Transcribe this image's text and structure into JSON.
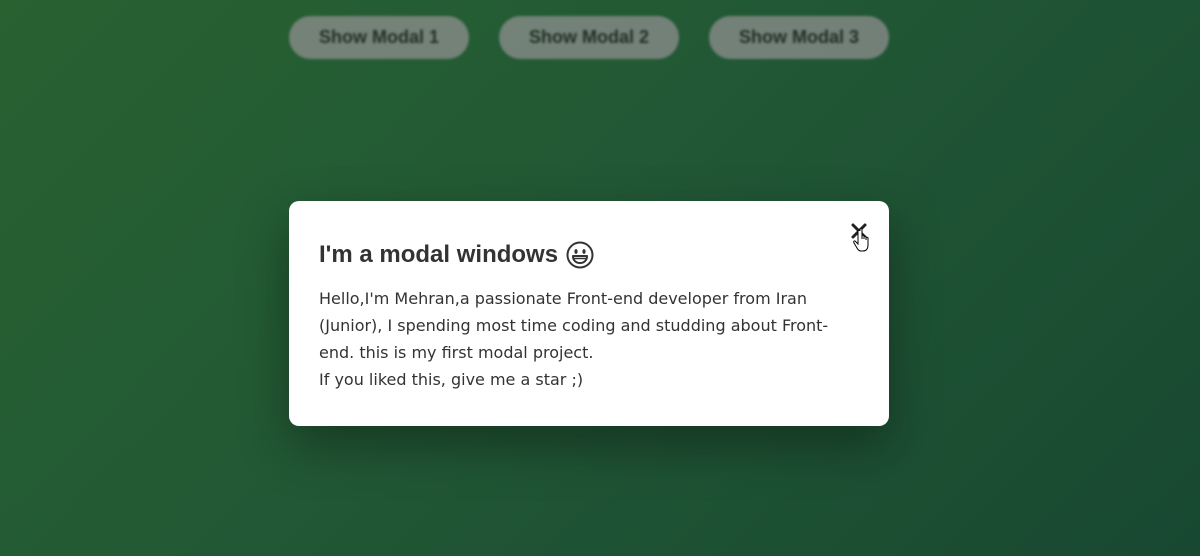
{
  "buttons": [
    {
      "label": "Show Modal 1"
    },
    {
      "label": "Show Modal 2"
    },
    {
      "label": "Show Modal 3"
    }
  ],
  "modal": {
    "title": "I'm a modal windows",
    "title_icon": "grinning-face-icon",
    "paragraph_1": "Hello,I'm Mehran,a passionate Front-end developer from Iran (Junior), I spending most time coding and studding about Front-end. this is my first modal project.",
    "paragraph_2": "If you liked this, give me a star ;)",
    "close_icon": "close-icon"
  },
  "colors": {
    "background_start": "#2d6a36",
    "background_end": "#1b4f36",
    "modal_bg": "#ffffff",
    "text": "#333333"
  },
  "cursor": "hand-pointer-icon"
}
